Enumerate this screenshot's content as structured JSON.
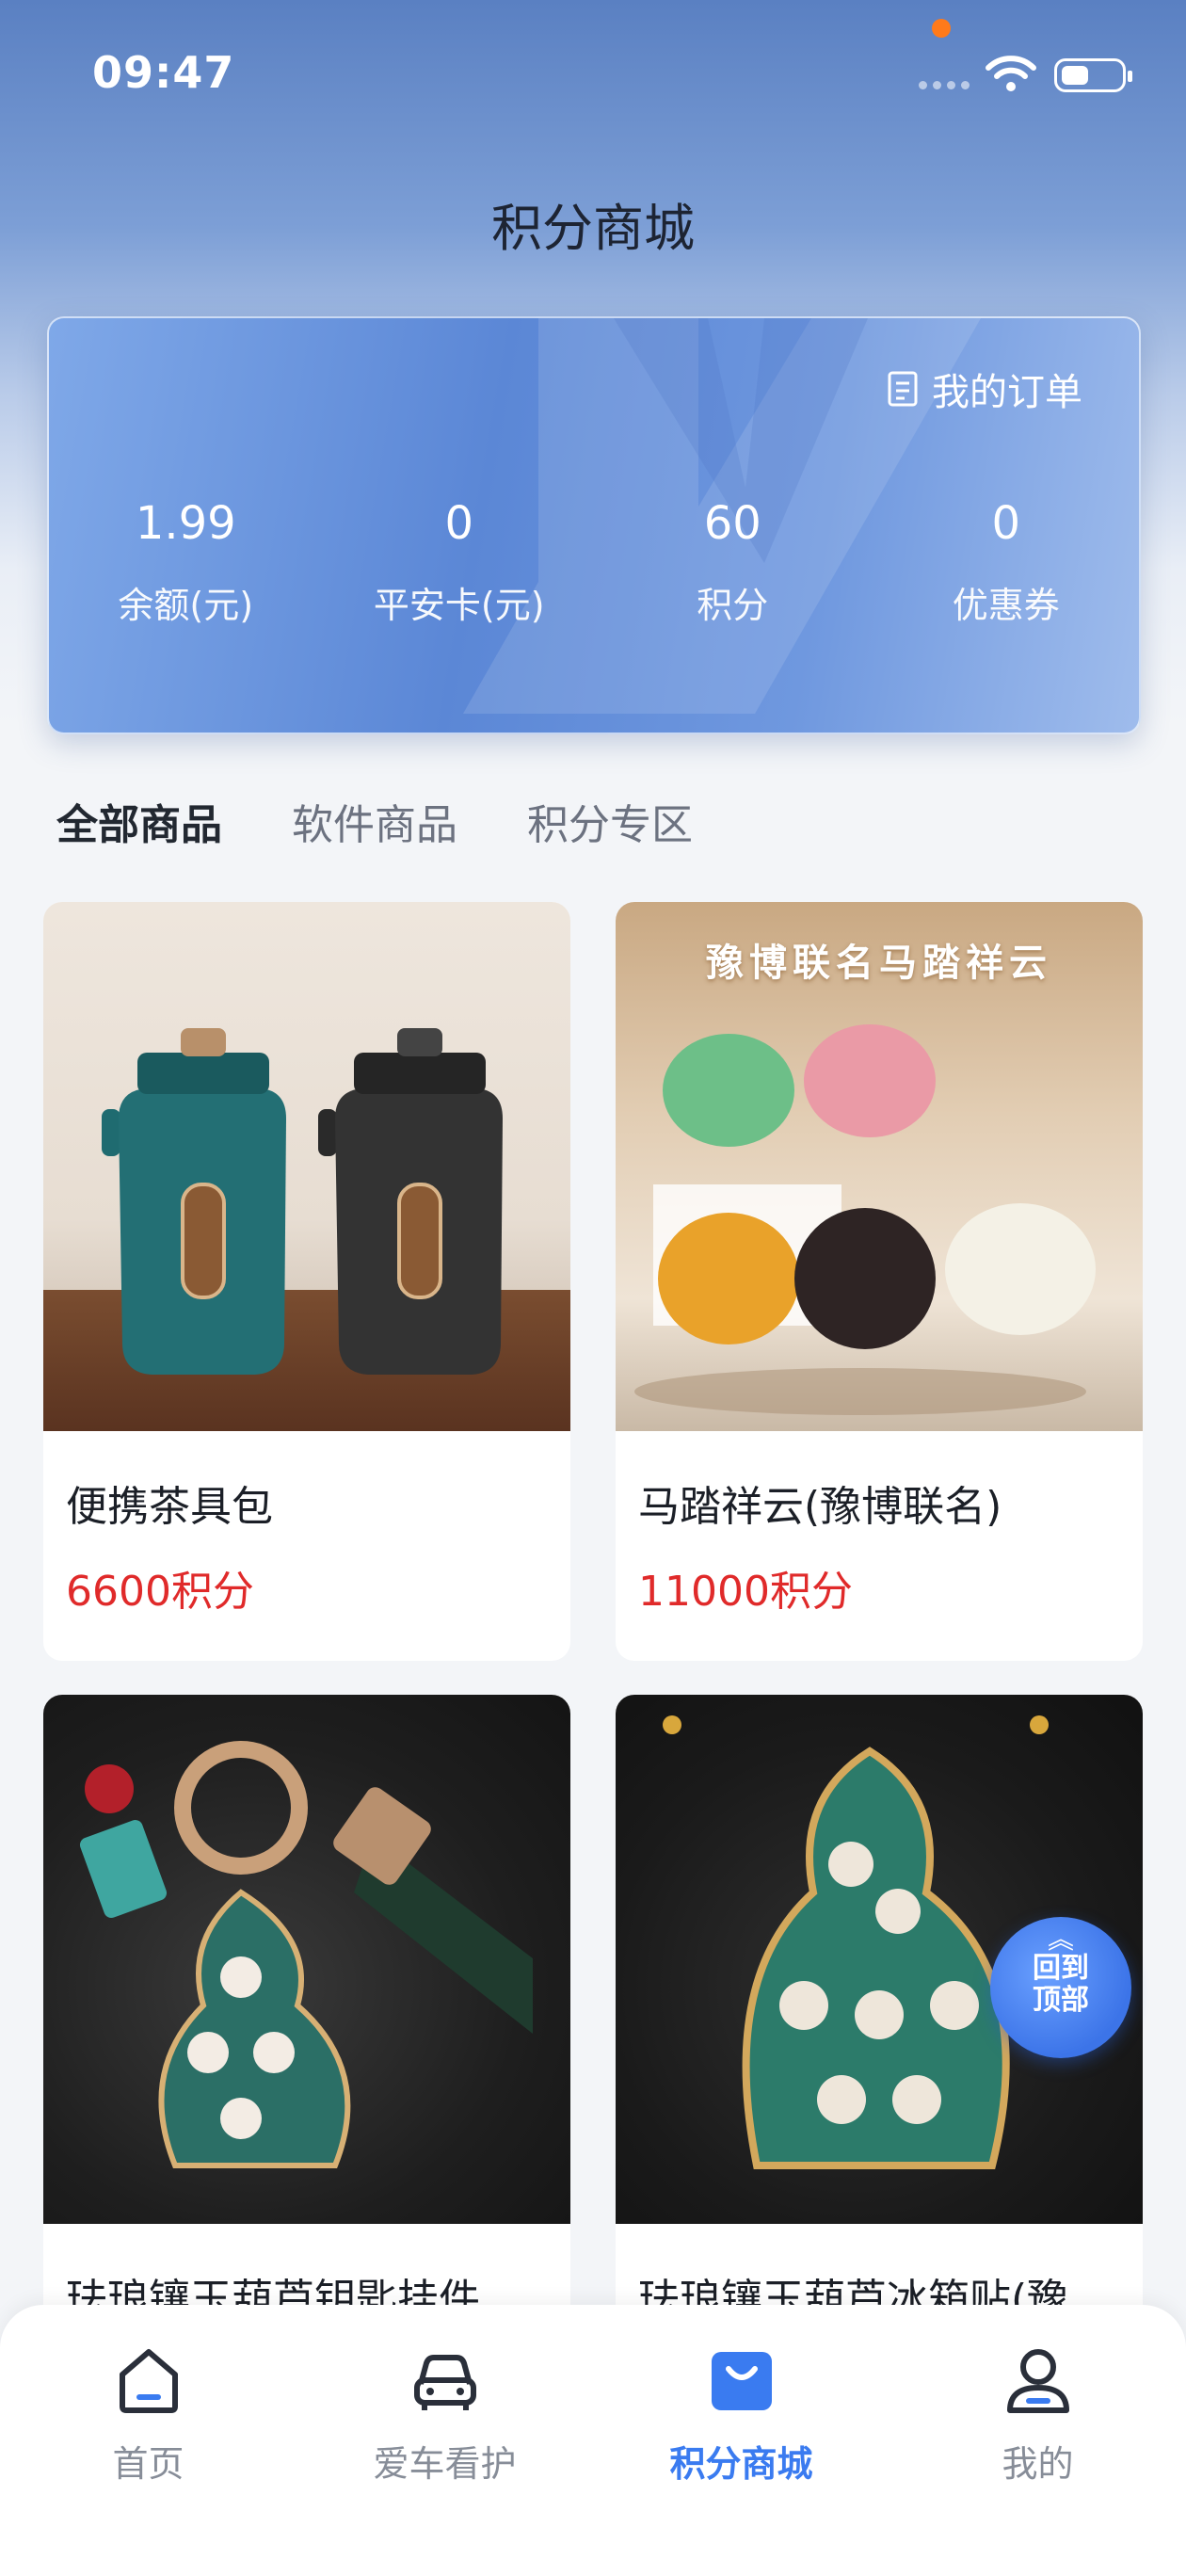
{
  "status_bar": {
    "time": "09:47"
  },
  "header": {
    "title": "积分商城"
  },
  "summary": {
    "orders_label": "我的订单",
    "stats": [
      {
        "value": "1.99",
        "label": "余额(元)"
      },
      {
        "value": "0",
        "label": "平安卡(元)"
      },
      {
        "value": "60",
        "label": "积分"
      },
      {
        "value": "0",
        "label": "优惠券"
      }
    ]
  },
  "tabs": [
    {
      "label": "全部商品",
      "active": true
    },
    {
      "label": "软件商品",
      "active": false
    },
    {
      "label": "积分专区",
      "active": false
    }
  ],
  "products": [
    {
      "name": "便携茶具包",
      "price": "6600积分"
    },
    {
      "name": "马踏祥云(豫博联名)",
      "price": "11000积分",
      "banner": "豫博联名马踏祥云"
    },
    {
      "name": "珐琅镶玉葫芦钥匙挂件",
      "price": ""
    },
    {
      "name": "珐琅镶玉葫芦冰箱贴(豫",
      "price": ""
    }
  ],
  "back_to_top": {
    "label": "回到顶部"
  },
  "bottom_nav": [
    {
      "label": "首页",
      "icon": "home-icon",
      "active": false
    },
    {
      "label": "爱车看护",
      "icon": "car-icon",
      "active": false
    },
    {
      "label": "积分商城",
      "icon": "shopping-bag-icon",
      "active": true
    },
    {
      "label": "我的",
      "icon": "user-icon",
      "active": false
    }
  ],
  "colors": {
    "accent": "#3a7bf0",
    "price": "#e02a2a",
    "header_bg": "#5a80c2"
  }
}
